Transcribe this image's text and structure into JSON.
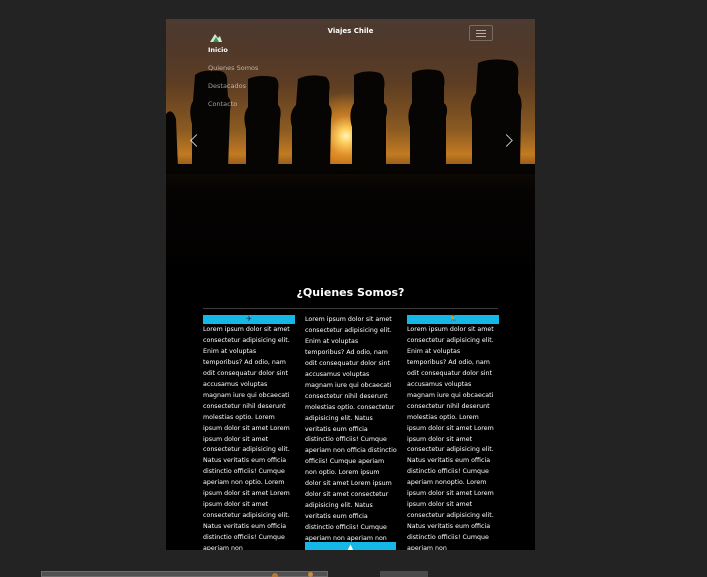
{
  "navbar": {
    "brand_icon": "mountain-logo-icon",
    "title": "Viajes Chile",
    "toggler_icon": "hamburger-icon",
    "menu": [
      {
        "label": "Inicio",
        "active": true
      },
      {
        "label": "Quienes Somos",
        "active": false
      },
      {
        "label": "Destacados",
        "active": false
      },
      {
        "label": "Contacto",
        "active": false
      }
    ]
  },
  "carousel": {
    "prev_icon": "chevron-left-icon",
    "next_icon": "chevron-right-icon"
  },
  "about": {
    "title": "¿Quienes Somos?",
    "columns": [
      {
        "icon": "plane-icon",
        "glyph": "✈",
        "text": "Lorem ipsum dolor sit amet consectetur adipisicing elit. Enim at voluptas temporibus? Ad odio, nam odit consequatur dolor sint accusamus voluptas magnam iure qui obcaecati consectetur nihil deserunt molestias optio. Lorem ipsum dolor sit amet Lorem ipsum dolor sit amet consectetur adipisicing elit. Natus veritatis eum officia distinctio officiis! Cumque aperiam non optio. Lorem ipsum dolor sit amet Lorem ipsum dolor sit amet consectetur adipisicing elit. Natus veritatis eum officia distinctio officiis! Cumque aperiam non"
      },
      {
        "text": "Lorem ipsum dolor sit amet consectetur adipisicing elit. Enim at voluptas temporibus? Ad odio, nam odit consequatur dolor sint accusamus voluptas magnam iure qui obcaecati consectetur nihil deserunt molestias optio. consectetur adipisicing elit. Natus veritatis eum officia distinctio officiis! Cumque aperiam non officia distinctio officiis! Cumque aperiam non optio. Lorem ipsum dolor sit amet Lorem ipsum dolor sit amet consectetur adipisicing elit. Natus veritatis eum officia distinctio officiis! Cumque aperiam non aperiam non",
        "bottom_icon": "mountain-icon",
        "bottom_glyph": "▲"
      },
      {
        "icon": "hiking-icon",
        "glyph": "🏃",
        "text": "Lorem ipsum dolor sit amet consectetur adipisicing elit. Enim at voluptas temporibus? Ad odio, nam odit consequatur dolor sint accusamus voluptas magnam iure qui obcaecati consectetur nihil deserunt molestias optio. Lorem ipsum dolor sit amet Lorem ipsum dolor sit amet consectetur adipisicing elit. Natus veritatis eum officia distinctio officiis! Cumque aperiam nonoptio. Lorem ipsum dolor sit amet Lorem ipsum dolor sit amet consectetur adipisicing elit. Natus veritatis eum officia distinctio officiis! Cumque aperiam non"
      }
    ]
  },
  "colors": {
    "accent": "#15b7e6",
    "background": "#000000",
    "outer": "#232324"
  }
}
